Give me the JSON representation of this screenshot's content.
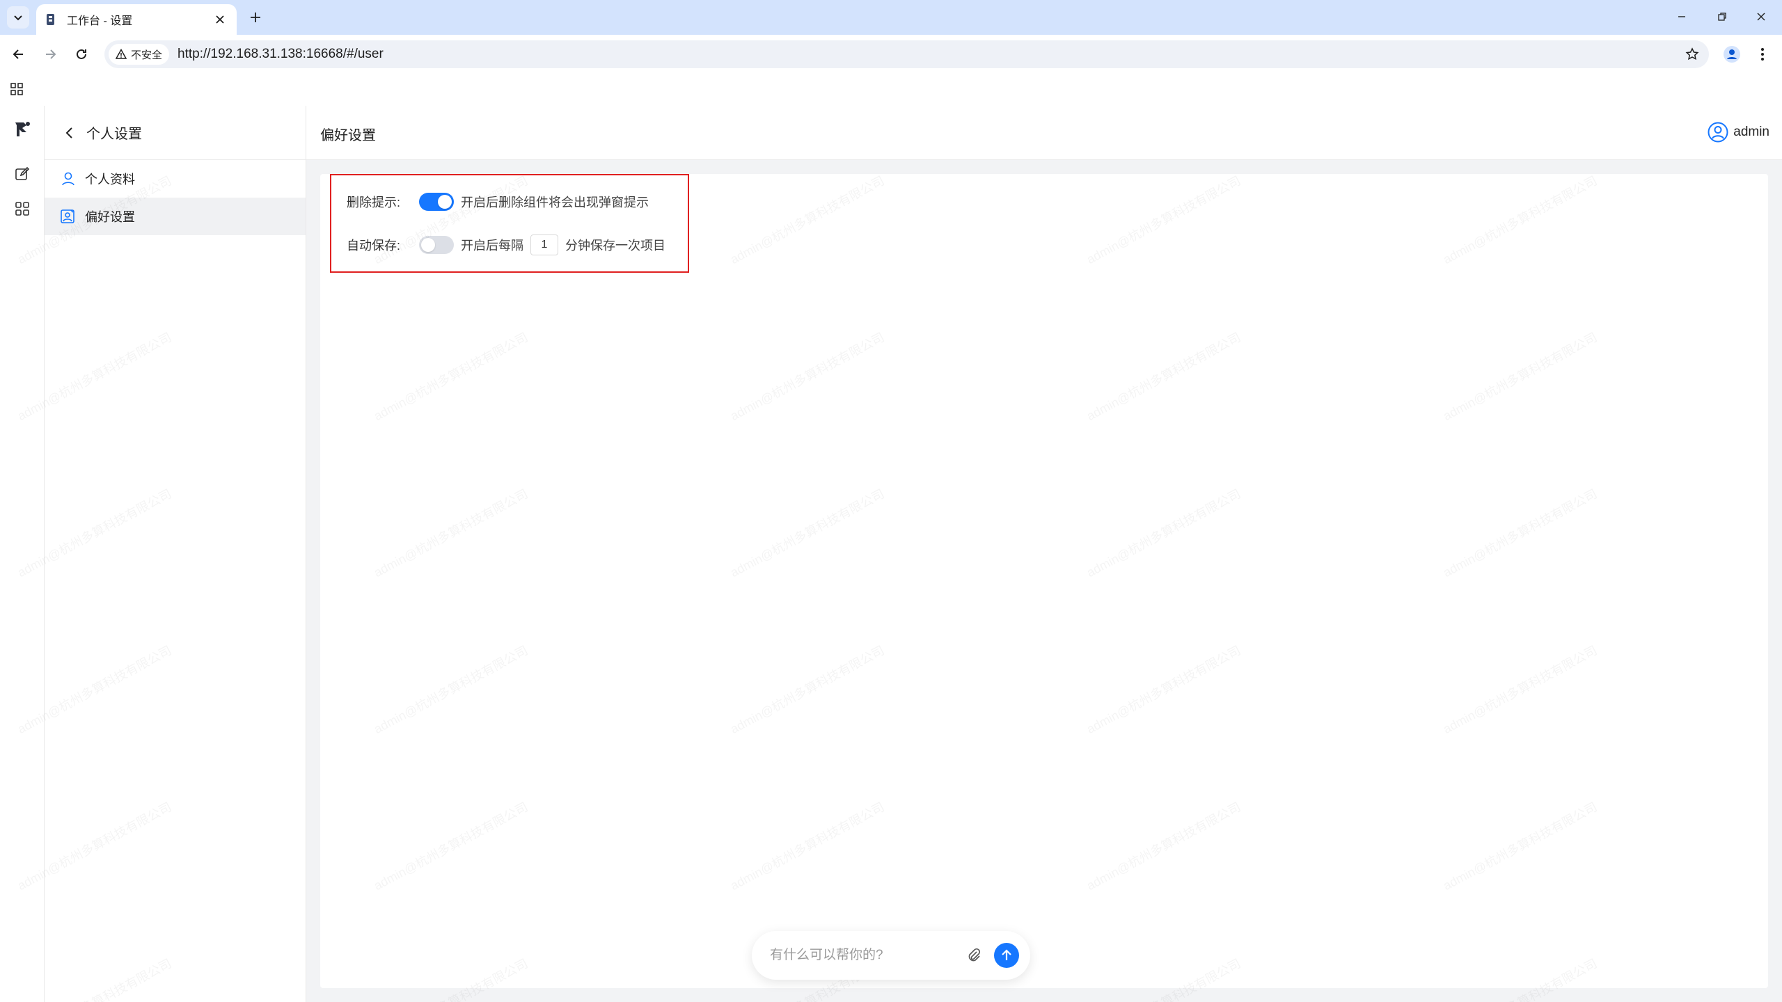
{
  "browser": {
    "tab_title": "工作台 - 设置",
    "security_label": "不安全",
    "url": "http://192.168.31.138:16668/#/user"
  },
  "sidebar": {
    "title": "个人设置",
    "items": [
      {
        "label": "个人资料",
        "active": false
      },
      {
        "label": "偏好设置",
        "active": true
      }
    ]
  },
  "header": {
    "title": "偏好设置",
    "user": "admin"
  },
  "settings": {
    "delete_prompt": {
      "label": "删除提示:",
      "enabled": true,
      "desc": "开启后删除组件将会出现弹窗提示"
    },
    "auto_save": {
      "label": "自动保存:",
      "enabled": false,
      "desc_before": "开启后每隔",
      "interval": "1",
      "desc_after": "分钟保存一次项目"
    }
  },
  "chat": {
    "placeholder": "有什么可以帮你的?"
  },
  "watermark": "admin@杭州多算科技有限公司",
  "colors": {
    "accent": "#1677ff",
    "highlight_border": "#e02020",
    "tabbar": "#d3e3fd"
  }
}
